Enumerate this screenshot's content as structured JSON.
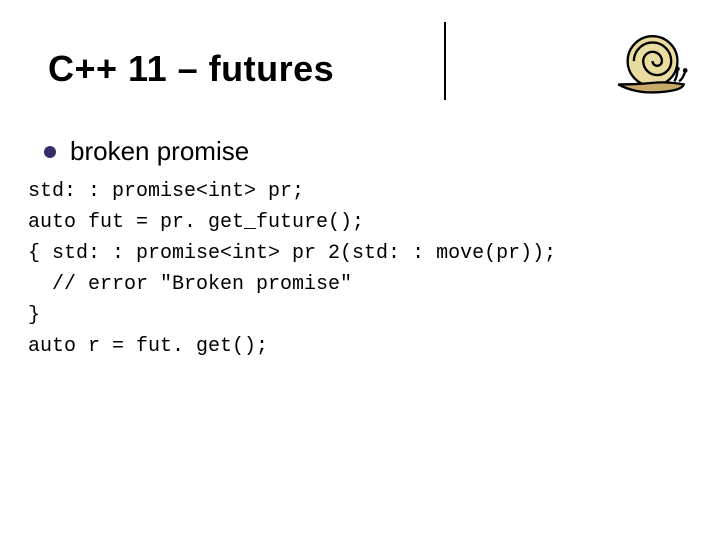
{
  "title": "C++ 11 – futures",
  "subtitle": "broken promise",
  "code": {
    "l1": "std: : promise<int> pr;",
    "l2": "auto fut = pr. get_future();",
    "l3": "{ std: : promise<int> pr 2(std: : move(pr));",
    "l4": "  // error \"Broken promise\"",
    "l5": "}",
    "l6": "auto r = fut. get();"
  }
}
